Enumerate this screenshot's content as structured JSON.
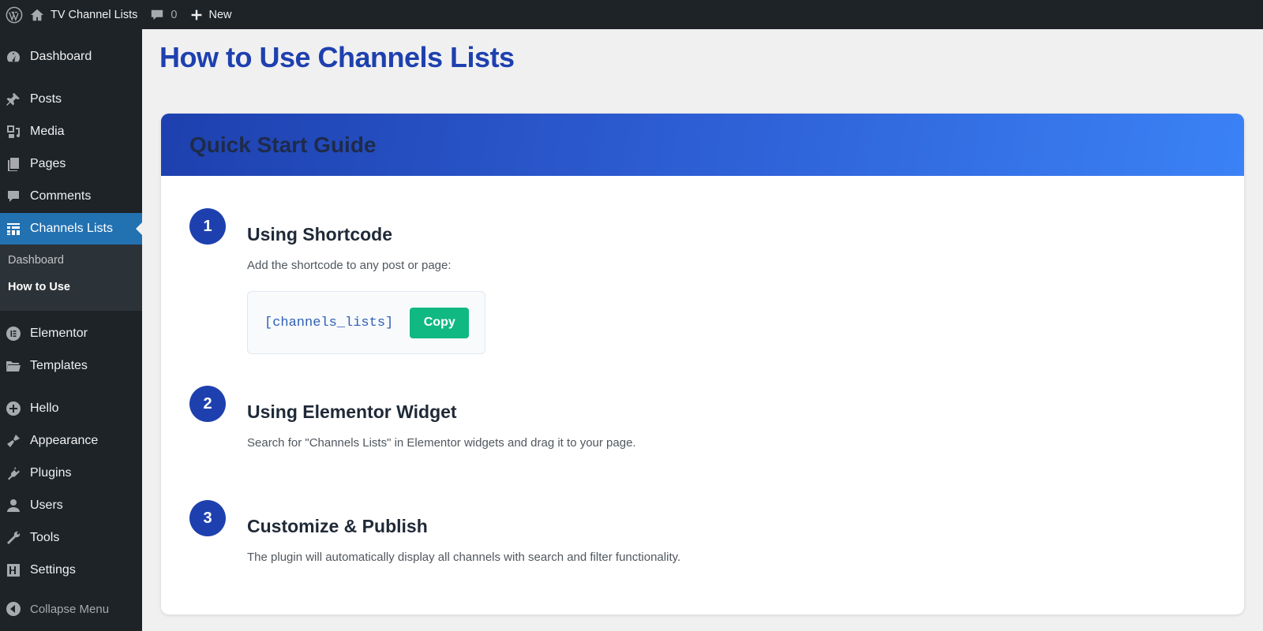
{
  "admin_bar": {
    "site_name": "TV Channel Lists",
    "comments_count": "0",
    "new_label": "New"
  },
  "sidebar": {
    "items": [
      {
        "label": "Dashboard",
        "icon": "dashboard-icon"
      },
      {
        "label": "Posts",
        "icon": "pin-icon"
      },
      {
        "label": "Media",
        "icon": "media-icon"
      },
      {
        "label": "Pages",
        "icon": "pages-icon"
      },
      {
        "label": "Comments",
        "icon": "comment-icon"
      },
      {
        "label": "Channels Lists",
        "icon": "list-icon",
        "active": true
      },
      {
        "label": "Elementor",
        "icon": "elementor-icon"
      },
      {
        "label": "Templates",
        "icon": "folder-icon"
      },
      {
        "label": "Hello",
        "icon": "plus-circle-icon"
      },
      {
        "label": "Appearance",
        "icon": "brush-icon"
      },
      {
        "label": "Plugins",
        "icon": "plugin-icon"
      },
      {
        "label": "Users",
        "icon": "user-icon"
      },
      {
        "label": "Tools",
        "icon": "wrench-icon"
      },
      {
        "label": "Settings",
        "icon": "settings-icon"
      }
    ],
    "submenu": [
      {
        "label": "Dashboard"
      },
      {
        "label": "How to Use",
        "current": true
      }
    ],
    "collapse_label": "Collapse Menu"
  },
  "page": {
    "title": "How to Use Channels Lists"
  },
  "guide": {
    "title": "Quick Start Guide",
    "steps": [
      {
        "number": "1",
        "title": "Using Shortcode",
        "description": "Add the shortcode to any post or page:"
      },
      {
        "number": "2",
        "title": "Using Elementor Widget",
        "description": "Search for \"Channels Lists\" in Elementor widgets and drag it to your page."
      },
      {
        "number": "3",
        "title": "Customize & Publish",
        "description": "The plugin will automatically display all channels with search and filter functionality."
      }
    ],
    "shortcode": "[channels_lists]",
    "copy_label": "Copy"
  },
  "colors": {
    "accent": "#1e40af",
    "admin_bg": "#1d2327",
    "active_menu": "#2271b1",
    "copy_button": "#10b981",
    "header_gradient_end": "#3b82f6"
  }
}
